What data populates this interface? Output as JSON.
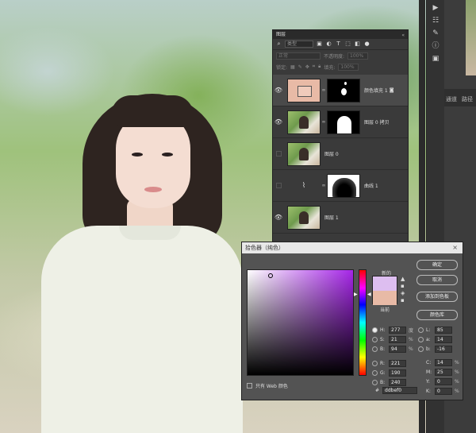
{
  "layers_panel": {
    "title": "图层",
    "filter_placeholder": "类型",
    "blend_mode": "正常",
    "opacity_label": "不透明度:",
    "opacity_value": "100%",
    "lock_label": "锁定:",
    "fill_label": "填充:",
    "fill_value": "100%",
    "layers": [
      {
        "name": "颜色填充 1",
        "visible": true,
        "selected": true
      },
      {
        "name": "图层 0 拷贝",
        "visible": true,
        "selected": false
      },
      {
        "name": "图层 0",
        "visible": false,
        "selected": false
      },
      {
        "name": "曲线 1",
        "visible": false,
        "selected": false
      },
      {
        "name": "图层 1",
        "visible": true,
        "selected": false
      }
    ]
  },
  "right_tabs": {
    "tab1": "通道",
    "tab2": "路径"
  },
  "color_picker": {
    "title": "拾色器（纯色）",
    "close_icon": "×",
    "new_label": "新的",
    "current_label": "当前",
    "new_color": "#ddbef0",
    "current_color": "#e8baa6",
    "buttons": {
      "ok": "确定",
      "cancel": "取消",
      "add_to_swatches": "添加到色板",
      "color_libraries": "颜色库"
    },
    "web_only_label": "只有 Web 颜色",
    "hsb": [
      {
        "label": "H:",
        "value": "277",
        "unit": "度",
        "selected": true
      },
      {
        "label": "S:",
        "value": "21",
        "unit": "%",
        "selected": false
      },
      {
        "label": "B:",
        "value": "94",
        "unit": "%",
        "selected": false
      }
    ],
    "rgb": [
      {
        "label": "R:",
        "value": "221",
        "selected": false
      },
      {
        "label": "G:",
        "value": "190",
        "selected": false
      },
      {
        "label": "B:",
        "value": "240",
        "selected": false
      }
    ],
    "lab": [
      {
        "label": "L:",
        "value": "85",
        "selected": false
      },
      {
        "label": "a:",
        "value": "14",
        "selected": false
      },
      {
        "label": "b:",
        "value": "-16",
        "selected": false
      }
    ],
    "cmyk": [
      {
        "label": "C:",
        "value": "14",
        "unit": "%"
      },
      {
        "label": "M:",
        "value": "25",
        "unit": "%"
      },
      {
        "label": "Y:",
        "value": "0",
        "unit": "%"
      },
      {
        "label": "K:",
        "value": "0",
        "unit": "%"
      }
    ],
    "hex_label": "#",
    "hex_value": "ddbef0"
  }
}
